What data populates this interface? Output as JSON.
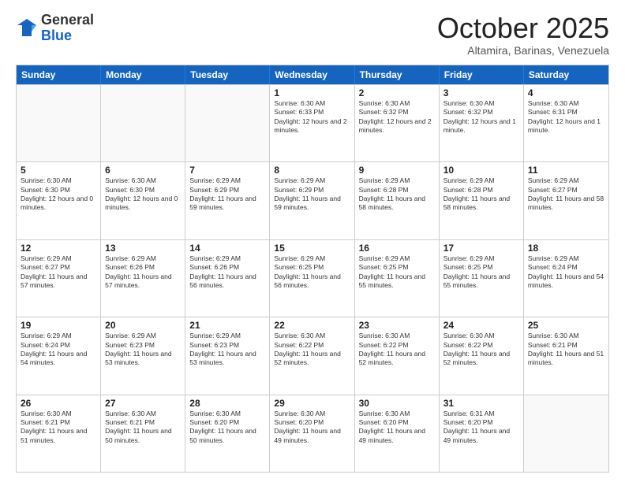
{
  "logo": {
    "general": "General",
    "blue": "Blue"
  },
  "title": "October 2025",
  "location": "Altamira, Barinas, Venezuela",
  "header_days": [
    "Sunday",
    "Monday",
    "Tuesday",
    "Wednesday",
    "Thursday",
    "Friday",
    "Saturday"
  ],
  "weeks": [
    [
      {
        "day": "",
        "sunrise": "",
        "sunset": "",
        "daylight": ""
      },
      {
        "day": "",
        "sunrise": "",
        "sunset": "",
        "daylight": ""
      },
      {
        "day": "",
        "sunrise": "",
        "sunset": "",
        "daylight": ""
      },
      {
        "day": "1",
        "sunrise": "Sunrise: 6:30 AM",
        "sunset": "Sunset: 6:33 PM",
        "daylight": "Daylight: 12 hours and 2 minutes."
      },
      {
        "day": "2",
        "sunrise": "Sunrise: 6:30 AM",
        "sunset": "Sunset: 6:32 PM",
        "daylight": "Daylight: 12 hours and 2 minutes."
      },
      {
        "day": "3",
        "sunrise": "Sunrise: 6:30 AM",
        "sunset": "Sunset: 6:32 PM",
        "daylight": "Daylight: 12 hours and 1 minute."
      },
      {
        "day": "4",
        "sunrise": "Sunrise: 6:30 AM",
        "sunset": "Sunset: 6:31 PM",
        "daylight": "Daylight: 12 hours and 1 minute."
      }
    ],
    [
      {
        "day": "5",
        "sunrise": "Sunrise: 6:30 AM",
        "sunset": "Sunset: 6:30 PM",
        "daylight": "Daylight: 12 hours and 0 minutes."
      },
      {
        "day": "6",
        "sunrise": "Sunrise: 6:30 AM",
        "sunset": "Sunset: 6:30 PM",
        "daylight": "Daylight: 12 hours and 0 minutes."
      },
      {
        "day": "7",
        "sunrise": "Sunrise: 6:29 AM",
        "sunset": "Sunset: 6:29 PM",
        "daylight": "Daylight: 11 hours and 59 minutes."
      },
      {
        "day": "8",
        "sunrise": "Sunrise: 6:29 AM",
        "sunset": "Sunset: 6:29 PM",
        "daylight": "Daylight: 11 hours and 59 minutes."
      },
      {
        "day": "9",
        "sunrise": "Sunrise: 6:29 AM",
        "sunset": "Sunset: 6:28 PM",
        "daylight": "Daylight: 11 hours and 58 minutes."
      },
      {
        "day": "10",
        "sunrise": "Sunrise: 6:29 AM",
        "sunset": "Sunset: 6:28 PM",
        "daylight": "Daylight: 11 hours and 58 minutes."
      },
      {
        "day": "11",
        "sunrise": "Sunrise: 6:29 AM",
        "sunset": "Sunset: 6:27 PM",
        "daylight": "Daylight: 11 hours and 58 minutes."
      }
    ],
    [
      {
        "day": "12",
        "sunrise": "Sunrise: 6:29 AM",
        "sunset": "Sunset: 6:27 PM",
        "daylight": "Daylight: 11 hours and 57 minutes."
      },
      {
        "day": "13",
        "sunrise": "Sunrise: 6:29 AM",
        "sunset": "Sunset: 6:26 PM",
        "daylight": "Daylight: 11 hours and 57 minutes."
      },
      {
        "day": "14",
        "sunrise": "Sunrise: 6:29 AM",
        "sunset": "Sunset: 6:26 PM",
        "daylight": "Daylight: 11 hours and 56 minutes."
      },
      {
        "day": "15",
        "sunrise": "Sunrise: 6:29 AM",
        "sunset": "Sunset: 6:25 PM",
        "daylight": "Daylight: 11 hours and 56 minutes."
      },
      {
        "day": "16",
        "sunrise": "Sunrise: 6:29 AM",
        "sunset": "Sunset: 6:25 PM",
        "daylight": "Daylight: 11 hours and 55 minutes."
      },
      {
        "day": "17",
        "sunrise": "Sunrise: 6:29 AM",
        "sunset": "Sunset: 6:25 PM",
        "daylight": "Daylight: 11 hours and 55 minutes."
      },
      {
        "day": "18",
        "sunrise": "Sunrise: 6:29 AM",
        "sunset": "Sunset: 6:24 PM",
        "daylight": "Daylight: 11 hours and 54 minutes."
      }
    ],
    [
      {
        "day": "19",
        "sunrise": "Sunrise: 6:29 AM",
        "sunset": "Sunset: 6:24 PM",
        "daylight": "Daylight: 11 hours and 54 minutes."
      },
      {
        "day": "20",
        "sunrise": "Sunrise: 6:29 AM",
        "sunset": "Sunset: 6:23 PM",
        "daylight": "Daylight: 11 hours and 53 minutes."
      },
      {
        "day": "21",
        "sunrise": "Sunrise: 6:29 AM",
        "sunset": "Sunset: 6:23 PM",
        "daylight": "Daylight: 11 hours and 53 minutes."
      },
      {
        "day": "22",
        "sunrise": "Sunrise: 6:30 AM",
        "sunset": "Sunset: 6:22 PM",
        "daylight": "Daylight: 11 hours and 52 minutes."
      },
      {
        "day": "23",
        "sunrise": "Sunrise: 6:30 AM",
        "sunset": "Sunset: 6:22 PM",
        "daylight": "Daylight: 11 hours and 52 minutes."
      },
      {
        "day": "24",
        "sunrise": "Sunrise: 6:30 AM",
        "sunset": "Sunset: 6:22 PM",
        "daylight": "Daylight: 11 hours and 52 minutes."
      },
      {
        "day": "25",
        "sunrise": "Sunrise: 6:30 AM",
        "sunset": "Sunset: 6:21 PM",
        "daylight": "Daylight: 11 hours and 51 minutes."
      }
    ],
    [
      {
        "day": "26",
        "sunrise": "Sunrise: 6:30 AM",
        "sunset": "Sunset: 6:21 PM",
        "daylight": "Daylight: 11 hours and 51 minutes."
      },
      {
        "day": "27",
        "sunrise": "Sunrise: 6:30 AM",
        "sunset": "Sunset: 6:21 PM",
        "daylight": "Daylight: 11 hours and 50 minutes."
      },
      {
        "day": "28",
        "sunrise": "Sunrise: 6:30 AM",
        "sunset": "Sunset: 6:20 PM",
        "daylight": "Daylight: 11 hours and 50 minutes."
      },
      {
        "day": "29",
        "sunrise": "Sunrise: 6:30 AM",
        "sunset": "Sunset: 6:20 PM",
        "daylight": "Daylight: 11 hours and 49 minutes."
      },
      {
        "day": "30",
        "sunrise": "Sunrise: 6:30 AM",
        "sunset": "Sunset: 6:20 PM",
        "daylight": "Daylight: 11 hours and 49 minutes."
      },
      {
        "day": "31",
        "sunrise": "Sunrise: 6:31 AM",
        "sunset": "Sunset: 6:20 PM",
        "daylight": "Daylight: 11 hours and 49 minutes."
      },
      {
        "day": "",
        "sunrise": "",
        "sunset": "",
        "daylight": ""
      }
    ]
  ]
}
